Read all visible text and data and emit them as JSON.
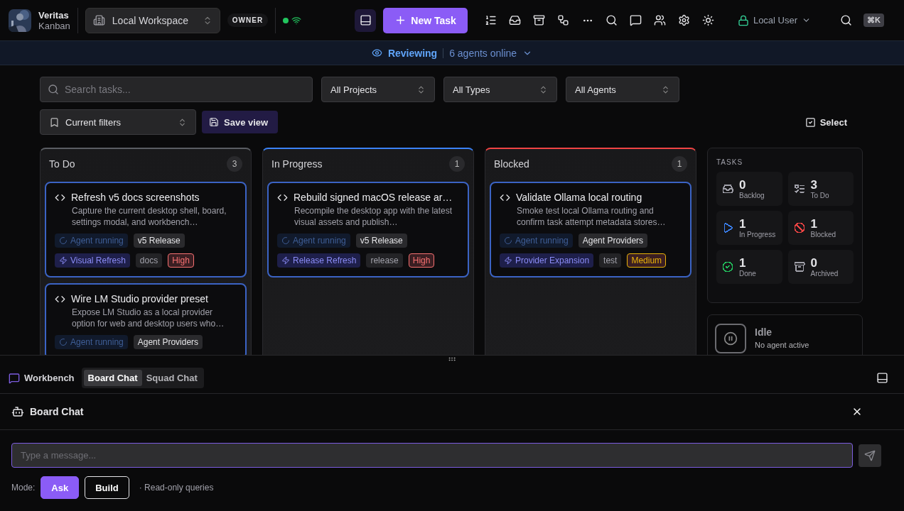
{
  "app": {
    "name": "Veritas",
    "subtitle": "Kanban"
  },
  "workspace": {
    "label": "Local Workspace"
  },
  "role": "OWNER",
  "connection": {
    "online": true
  },
  "layout_toggle": {
    "selected": true
  },
  "new_task": "New Task",
  "user": "Local User",
  "shortcut": "⌘K",
  "banner": {
    "status": "Reviewing",
    "agents": "6 agents online"
  },
  "filters": {
    "search_placeholder": "Search tasks...",
    "selects": [
      "All Projects",
      "All Types",
      "All Agents"
    ],
    "saved": "Current filters",
    "save_view": "Save view",
    "select": "Select"
  },
  "columns": [
    {
      "title": "To Do",
      "count": "3",
      "color": "#5a5d63",
      "cards": [
        {
          "title": "Refresh v5 docs screenshots",
          "description": "Capture the current desktop shell, board, settings modal, and workbench…",
          "tags": [
            [
              {
                "kind": "agent",
                "text": "Agent running"
              },
              {
                "kind": "group",
                "text": "v5 Release"
              }
            ],
            [
              {
                "kind": "epic",
                "text": "Visual Refresh"
              },
              {
                "kind": "label",
                "text": "docs"
              },
              {
                "kind": "priority",
                "text": "High",
                "color": "#f87171"
              }
            ]
          ]
        },
        {
          "title": "Wire LM Studio provider preset",
          "description": "Expose LM Studio as a local provider option for web and desktop users who…",
          "tags": [
            [
              {
                "kind": "agent",
                "text": "Agent running"
              },
              {
                "kind": "group",
                "text": "Agent Providers"
              }
            ]
          ]
        }
      ]
    },
    {
      "title": "In Progress",
      "count": "1",
      "color": "#3b82f6",
      "cards": [
        {
          "title": "Rebuild signed macOS release ar…",
          "description": "Recompile the desktop app with the latest visual assets and publish…",
          "tags": [
            [
              {
                "kind": "agent",
                "text": "Agent running"
              },
              {
                "kind": "group",
                "text": "v5 Release"
              }
            ],
            [
              {
                "kind": "epic",
                "text": "Release Refresh"
              },
              {
                "kind": "label",
                "text": "release"
              },
              {
                "kind": "priority",
                "text": "High",
                "color": "#f87171"
              }
            ]
          ]
        }
      ]
    },
    {
      "title": "Blocked",
      "count": "1",
      "color": "#ef4444",
      "cards": [
        {
          "title": "Validate Ollama local routing",
          "description": "Smoke test local Ollama routing and confirm task attempt metadata stores…",
          "tags": [
            [
              {
                "kind": "agent",
                "text": "Agent running"
              },
              {
                "kind": "group",
                "text": "Agent Providers"
              }
            ],
            [
              {
                "kind": "epic",
                "text": "Provider Expansion"
              },
              {
                "kind": "label",
                "text": "test"
              },
              {
                "kind": "priority",
                "text": "Medium",
                "color": "#eab308"
              }
            ]
          ]
        }
      ]
    }
  ],
  "stats": {
    "title": "TASKS",
    "items": [
      {
        "kind": "backlog",
        "value": "0",
        "label": "Backlog",
        "color": "#a1a1aa"
      },
      {
        "kind": "todo",
        "value": "3",
        "label": "To Do",
        "color": "#a1a1aa"
      },
      {
        "kind": "progress",
        "value": "1",
        "label": "In Progress",
        "color": "#3b82f6"
      },
      {
        "kind": "blocked",
        "value": "1",
        "label": "Blocked",
        "color": "#ef4444"
      },
      {
        "kind": "done",
        "value": "1",
        "label": "Done",
        "color": "#22c55e"
      },
      {
        "kind": "archived",
        "value": "0",
        "label": "Archived",
        "color": "#a1a1aa"
      }
    ]
  },
  "agent": {
    "status": "Idle",
    "detail": "No agent active"
  },
  "workbench": {
    "title": "Workbench",
    "tabs": [
      {
        "label": "Board Chat",
        "selected": true
      },
      {
        "label": "Squad Chat",
        "selected": false
      }
    ]
  },
  "chat": {
    "title": "Board Chat",
    "placeholder": "Type a message...",
    "mode_label": "Mode:",
    "modes": [
      {
        "label": "Ask",
        "selected": true
      },
      {
        "label": "Build",
        "selected": false
      }
    ],
    "mode_hint": "· Read-only queries"
  }
}
